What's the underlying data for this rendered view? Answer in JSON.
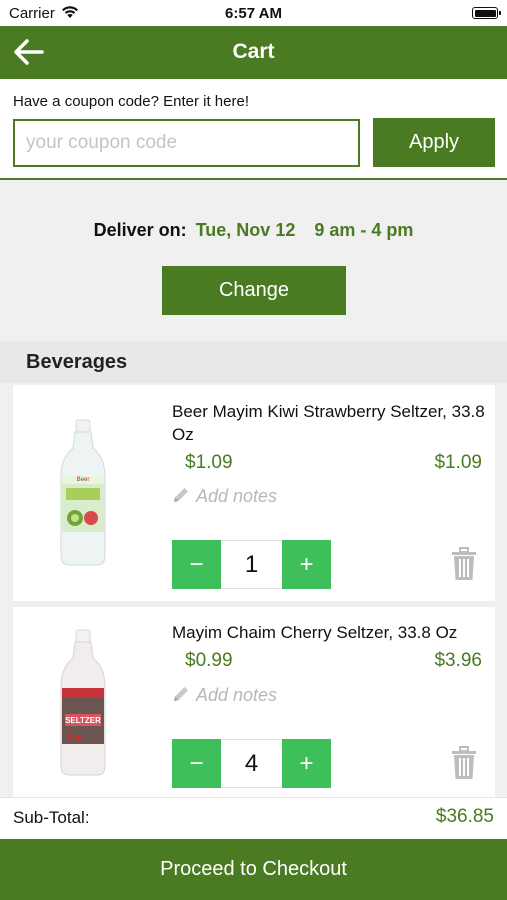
{
  "status_bar": {
    "carrier": "Carrier",
    "time": "6:57 AM",
    "wifi_icon": "wifi-icon",
    "battery_icon": "battery-icon"
  },
  "nav": {
    "title": "Cart",
    "back_icon": "back-arrow-icon"
  },
  "coupon": {
    "prompt": "Have a coupon code? Enter it here!",
    "placeholder": "your coupon code",
    "value": "",
    "apply_label": "Apply"
  },
  "delivery": {
    "label": "Deliver on:",
    "date": "Tue, Nov 12",
    "time": "9 am - 4 pm",
    "change_label": "Change"
  },
  "category": "Beverages",
  "items": [
    {
      "name": "Beer Mayim Kiwi Strawberry Seltzer, 33.8 Oz",
      "unit_price": "$1.09",
      "line_total": "$1.09",
      "notes_placeholder": "Add notes",
      "quantity": "1",
      "decrement": "−",
      "increment": "+",
      "image_icon": "kiwi-strawberry-seltzer-bottle",
      "delete_icon": "trash-icon"
    },
    {
      "name": "Mayim Chaim Cherry Seltzer, 33.8 Oz",
      "unit_price": "$0.99",
      "line_total": "$3.96",
      "notes_placeholder": "Add notes",
      "quantity": "4",
      "decrement": "−",
      "increment": "+",
      "image_icon": "cherry-seltzer-bottle",
      "delete_icon": "trash-icon"
    }
  ],
  "subtotal": {
    "label": "Sub-Total:",
    "value": "$36.85"
  },
  "checkout_label": "Proceed to Checkout",
  "colors": {
    "brand_green": "#4a7a22",
    "stepper_green": "#3fbf5a",
    "background": "#f0f0f0"
  }
}
